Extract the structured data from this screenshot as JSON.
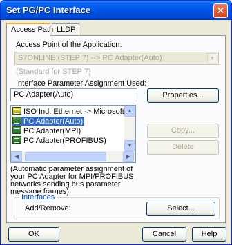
{
  "window": {
    "title": "Set PG/PC Interface",
    "close_symbol": "✕"
  },
  "tabs": [
    {
      "label": "Access Path"
    },
    {
      "label": "LLDP"
    }
  ],
  "access_point": {
    "label": "Access Point of the Application:",
    "value": "S7ONLINE    (STEP 7)      --> PC Adapter(Auto)",
    "note": "(Standard for STEP 7)"
  },
  "parameter_assignment": {
    "label": "Interface Parameter Assignment Used:",
    "value": "PC Adapter(Auto)"
  },
  "interface_list": {
    "items": [
      {
        "label": "ISO Ind. Ethernet -> Microsoft TV/V",
        "icon": "yellow-network-card-icon"
      },
      {
        "label": "PC Adapter(Auto)",
        "icon": "green-network-card-icon",
        "selected": true
      },
      {
        "label": "PC Adapter(MPI)",
        "icon": "green-network-card-icon"
      },
      {
        "label": "PC Adapter(PROFIBUS)",
        "icon": "green-network-card-icon"
      }
    ]
  },
  "buttons": {
    "properties": "Properties...",
    "copy": "Copy...",
    "delete": "Delete",
    "select": "Select...",
    "ok": "OK",
    "cancel": "Cancel",
    "help": "Help"
  },
  "description": "(Automatic parameter assignment of your PC Adapter for MPI/PROFIBUS networks sending bus parameter message frames)",
  "interfaces": {
    "title": "Interfaces",
    "add_remove_label": "Add/Remove:"
  },
  "scroll_glyphs": {
    "up": "▲",
    "down": "▼",
    "left": "◀",
    "right": "▶",
    "dropdown": "▼"
  },
  "colors": {
    "title_bar": "#0055e5",
    "selection": "#316ac5",
    "dialog_bg": "#ece9d8"
  }
}
